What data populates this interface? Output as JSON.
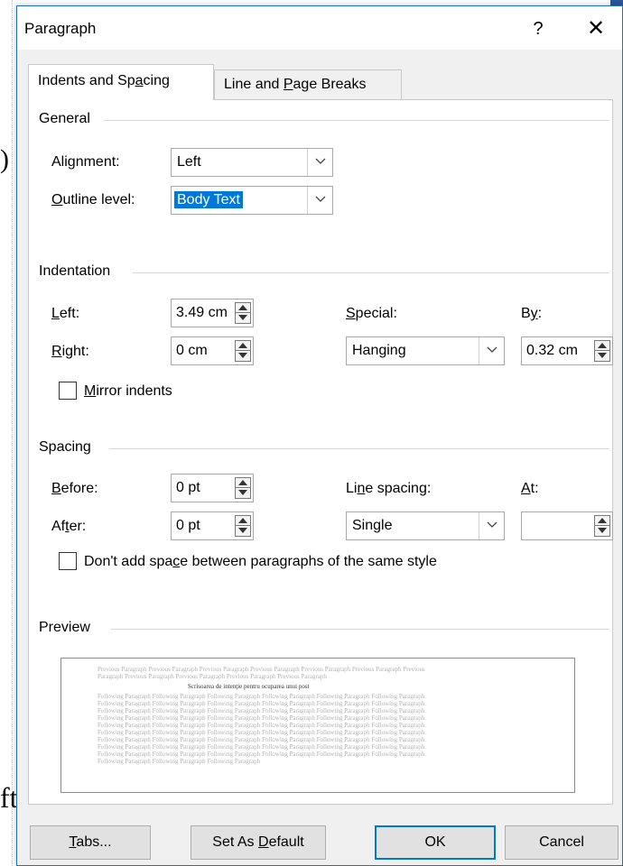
{
  "dialog": {
    "title": "Paragraph",
    "help": "?",
    "close": "✕"
  },
  "tabs": [
    {
      "label_pre": "Indents and Sp",
      "label_u": "a",
      "label_post": "cing",
      "active": true
    },
    {
      "label_pre": "Line and ",
      "label_u": "P",
      "label_post": "age Breaks",
      "active": false
    }
  ],
  "general": {
    "heading": "General",
    "alignment_label_pre": "Ali",
    "alignment_label_u": "g",
    "alignment_label_post": "nment:",
    "alignment_value": "Left",
    "outline_label_pre": "",
    "outline_label_u": "O",
    "outline_label_post": "utline level:",
    "outline_value": "Body Text"
  },
  "indentation": {
    "heading": "Indentation",
    "left_label_u": "L",
    "left_label_post": "eft:",
    "left_value": "3.49 cm",
    "right_label_u": "R",
    "right_label_post": "ight:",
    "right_value": "0 cm",
    "special_label_u": "S",
    "special_label_post": "pecial:",
    "special_value": "Hanging",
    "by_label_pre": "B",
    "by_label_u": "y",
    "by_label_post": ":",
    "by_value": "0.32 cm",
    "mirror_label_u": "M",
    "mirror_label_post": "irror indents"
  },
  "spacing": {
    "heading": "Spacing",
    "before_label_u": "B",
    "before_label_post": "efore:",
    "before_value": "0 pt",
    "after_label_pre": "Af",
    "after_label_u": "t",
    "after_label_post": "er:",
    "after_value": "0 pt",
    "line_spacing_label_pre": "Li",
    "line_spacing_label_u": "n",
    "line_spacing_label_post": "e spacing:",
    "line_spacing_value": "Single",
    "at_label_u": "A",
    "at_label_post": "t:",
    "at_value": "",
    "dont_add_pre": "Don't add spa",
    "dont_add_u": "c",
    "dont_add_post": "e between paragraphs of the same style"
  },
  "preview": {
    "heading": "Preview",
    "prev_line1": "Previous Paragraph Previous Paragraph Previous Paragraph Previous Paragraph Previous Paragraph Previous Paragraph Previous",
    "prev_line2": "Paragraph Previous Paragraph Previous Paragraph Previous Paragraph Previous Paragraph",
    "sample": "Scrisoarea de intenţie pentru ocuparea unui post",
    "following_line": "Following Paragraph Following Paragraph Following Paragraph Following Paragraph Following Paragraph Following Paragraph",
    "following_last": "Following Paragraph Following Paragraph Following Paragraph"
  },
  "buttons": {
    "tabs_u": "T",
    "tabs_post": "abs...",
    "set_default_pre": "Set As ",
    "set_default_u": "D",
    "set_default_post": "efault",
    "ok": "OK",
    "cancel": "Cancel"
  },
  "background": {
    "mark_ft": "ft",
    "mark_paren": ")"
  }
}
